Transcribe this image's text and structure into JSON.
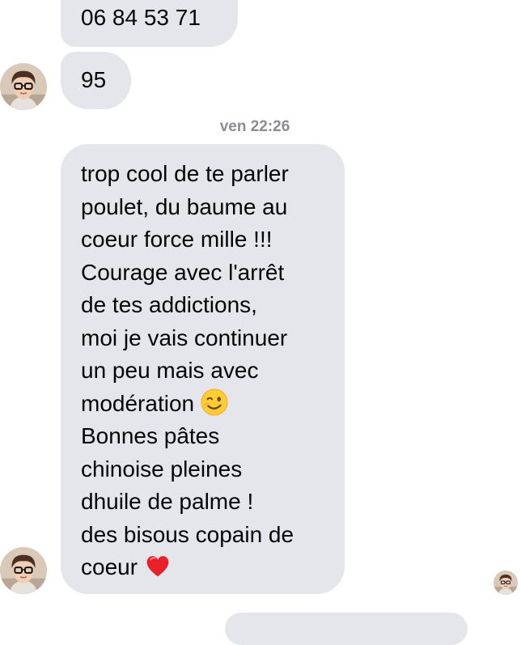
{
  "messages": [
    {
      "lines": [
        "06 84 53 71"
      ]
    },
    {
      "lines": [
        "95"
      ]
    }
  ],
  "timestamp": "ven 22:26",
  "long_message": {
    "lines": [
      "trop cool de te parler",
      "poulet, du baume au",
      "coeur force mille !!!",
      "Courage avec l'arrêt",
      "de tes addictions,",
      "moi je vais continuer",
      "un peu mais avec",
      "modération",
      "Bonnes pâtes",
      "chinoise pleines",
      "dhuile de palme !",
      "des bisous copain de",
      "coeur"
    ],
    "emojis": [
      "winking-face-emoji",
      "red-heart-emoji"
    ]
  },
  "avatars": {
    "contact": "contact-avatar",
    "seen": "seen-receipt-avatar"
  },
  "colors": {
    "bubble": "#e4e6eb",
    "timestamp": "#8a8d91",
    "text": "#050505"
  }
}
